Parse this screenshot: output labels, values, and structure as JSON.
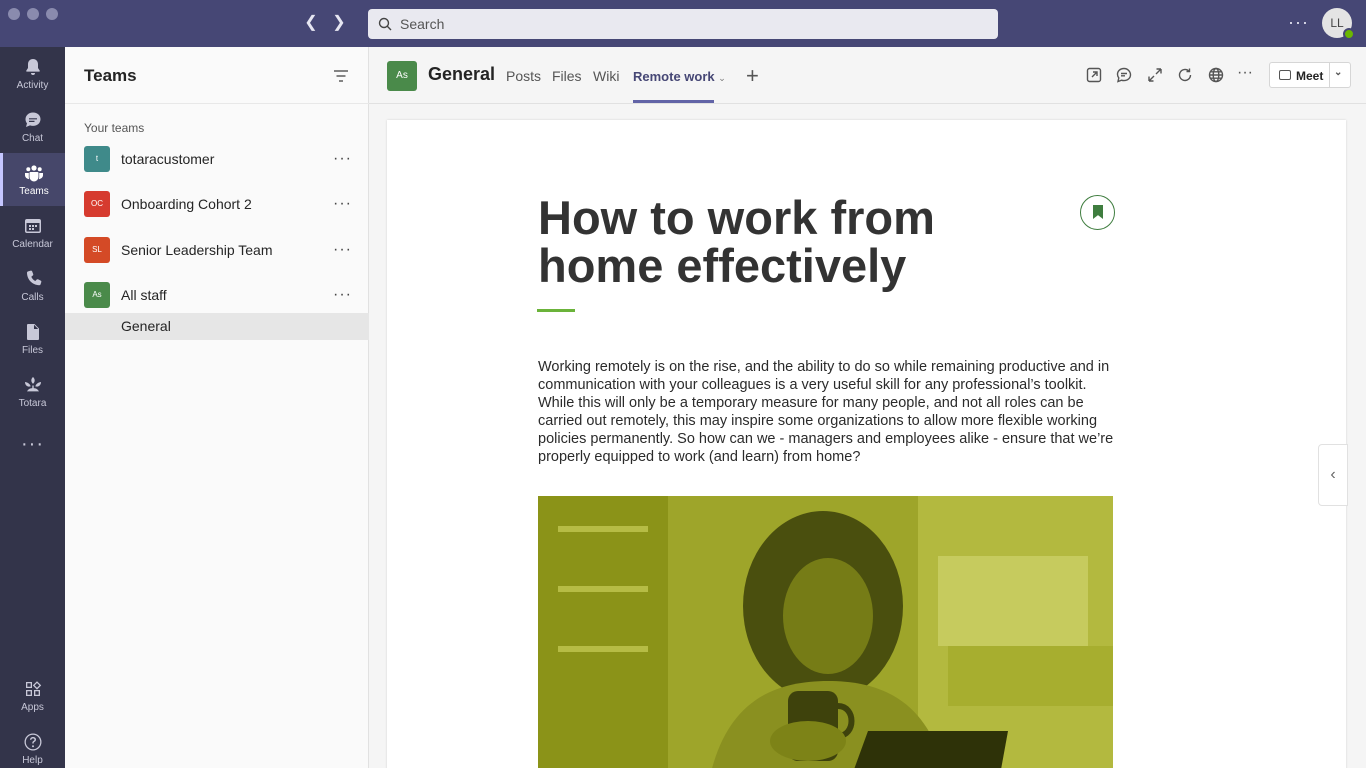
{
  "window": {
    "search_placeholder": "Search",
    "avatar_initials": "LL"
  },
  "rail": [
    {
      "label": "Activity"
    },
    {
      "label": "Chat"
    },
    {
      "label": "Teams"
    },
    {
      "label": "Calendar"
    },
    {
      "label": "Calls"
    },
    {
      "label": "Files"
    },
    {
      "label": "Totara"
    },
    {
      "label": "Apps"
    },
    {
      "label": "Help"
    }
  ],
  "panel": {
    "title": "Teams",
    "section": "Your teams",
    "teams": [
      {
        "initials": "t",
        "name": "totaracustomer",
        "color": "#3f8a8a"
      },
      {
        "initials": "OC",
        "name": "Onboarding Cohort 2",
        "color": "#d63b2f"
      },
      {
        "initials": "SL",
        "name": "Senior Leadership Team",
        "color": "#d44a26"
      },
      {
        "initials": "As",
        "name": "All staff",
        "color": "#4a8a4a"
      }
    ],
    "channel": "General"
  },
  "channel": {
    "initials": "As",
    "title": "General",
    "tabs": [
      "Posts",
      "Files",
      "Wiki",
      "Remote work"
    ],
    "meet_label": "Meet"
  },
  "article": {
    "title": "How to work from home effectively",
    "body": "Working remotely is on the rise, and the ability to do so while remaining productive and in communication with your colleagues is a very useful skill for any professional’s toolkit. While this will only be a temporary measure for many people, and not all roles can be carried out remotely, this may inspire some organizations to allow more flexible working policies permanently. So how can we - managers and employees alike - ensure that we’re properly equipped to work (and learn) from home?"
  }
}
